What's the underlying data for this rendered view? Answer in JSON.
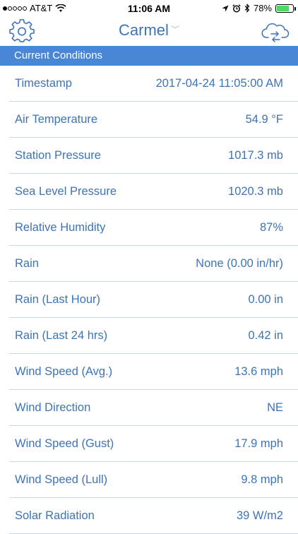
{
  "status": {
    "carrier": "AT&T",
    "time": "11:06 AM",
    "battery": "78%",
    "battery_level": 0.78,
    "icons": [
      "wifi-icon",
      "location-arrow-icon",
      "alarm-icon",
      "bluetooth-icon",
      "battery-icon"
    ]
  },
  "nav": {
    "title": "Carmel",
    "title_chevron": "﹀",
    "left_icon": "gear-icon",
    "right_icon": "cloud-sync-icon"
  },
  "section": {
    "title": "Current Conditions"
  },
  "rows": [
    {
      "label": "Timestamp",
      "value": "2017-04-24 11:05:00 AM"
    },
    {
      "label": "Air Temperature",
      "value": "54.9 °F"
    },
    {
      "label": "Station Pressure",
      "value": "1017.3 mb"
    },
    {
      "label": "Sea Level Pressure",
      "value": "1020.3 mb"
    },
    {
      "label": "Relative Humidity",
      "value": "87%"
    },
    {
      "label": "Rain",
      "value": "None (0.00 in/hr)"
    },
    {
      "label": "Rain (Last Hour)",
      "value": "0.00 in"
    },
    {
      "label": "Rain (Last 24 hrs)",
      "value": "0.42 in"
    },
    {
      "label": "Wind Speed (Avg.)",
      "value": "13.6 mph"
    },
    {
      "label": "Wind Direction",
      "value": "NE"
    },
    {
      "label": "Wind Speed (Gust)",
      "value": "17.9 mph"
    },
    {
      "label": "Wind Speed (Lull)",
      "value": "9.8 mph"
    },
    {
      "label": "Solar Radiation",
      "value": "39 W/m2"
    }
  ],
  "colors": {
    "accent": "#3d74b5",
    "header_bg": "#4a86d6",
    "divider": "#c9d6e8",
    "battery_fill": "#4cd964"
  }
}
